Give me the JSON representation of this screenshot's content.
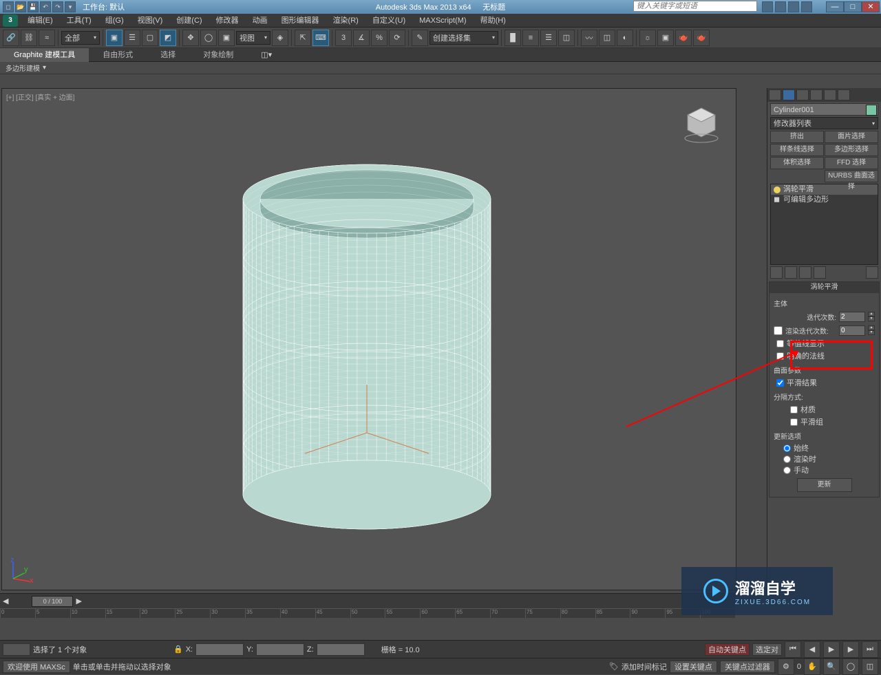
{
  "titlebar": {
    "workspace_label": "工作台: 默认",
    "app_title": "Autodesk 3ds Max  2013 x64",
    "doc_title": "无标题",
    "search_placeholder": "键入关键字或短语"
  },
  "menu": [
    "编辑(E)",
    "工具(T)",
    "组(G)",
    "视图(V)",
    "创建(C)",
    "修改器",
    "动画",
    "图形编辑器",
    "渲染(R)",
    "自定义(U)",
    "MAXScript(M)",
    "帮助(H)"
  ],
  "toolbar": {
    "filter_dd": "全部",
    "view_dd": "视图",
    "named_sel_dd": "创建选择集"
  },
  "ribbon": {
    "tabs": [
      "Graphite 建模工具",
      "自由形式",
      "选择",
      "对象绘制"
    ],
    "subtab": "多边形建模"
  },
  "viewport": {
    "label": "[+] [正交] [真实 + 边面]"
  },
  "right_panel": {
    "object_name": "Cylinder001",
    "modifier_dd": "修改器列表",
    "mod_buttons": [
      [
        "挤出",
        "面片选择"
      ],
      [
        "样条线选择",
        "多边形选择"
      ],
      [
        "体积选择",
        "FFD 选择"
      ],
      [
        "",
        "NURBS 曲面选择"
      ]
    ],
    "stack": [
      "涡轮平滑",
      "可编辑多边形"
    ],
    "rollout_title": "涡轮平滑",
    "main_label": "主体",
    "iter_label": "迭代次数:",
    "iter_value": "2",
    "render_iter_label": "渲染迭代次数:",
    "render_iter_value": "0",
    "iso_label": "等值线显示",
    "normal_label": "明确的法线",
    "surf_params": "曲面参数",
    "smooth_result": "平滑结果",
    "sep_label": "分隔方式:",
    "mat_label": "材质",
    "sg_label": "平滑组",
    "update_opts": "更新选项",
    "upd_always": "始终",
    "upd_render": "渲染时",
    "upd_manual": "手动",
    "update_btn": "更新"
  },
  "timeline": {
    "knob": "0 / 100",
    "ticks": [
      "0",
      "5",
      "10",
      "15",
      "20",
      "25",
      "30",
      "35",
      "40",
      "45",
      "50",
      "55",
      "60",
      "65",
      "70",
      "75",
      "80",
      "85",
      "90",
      "95",
      "100"
    ]
  },
  "status": {
    "sel": "选择了 1 个对象",
    "x": "X:",
    "y": "Y:",
    "z": "Z:",
    "grid": "栅格 = 10.0",
    "autokey": "自动关键点",
    "selset": "选定对"
  },
  "bottom": {
    "welcome": "欢迎使用  MAXSc",
    "hint": "单击或单击并拖动以选择对象",
    "addtime": "添加时间标记",
    "setkey": "设置关键点",
    "keyfilter": "关键点过滤器"
  },
  "watermark": {
    "big": "溜溜自学",
    "sm": "ZIXUE.3D66.COM"
  }
}
